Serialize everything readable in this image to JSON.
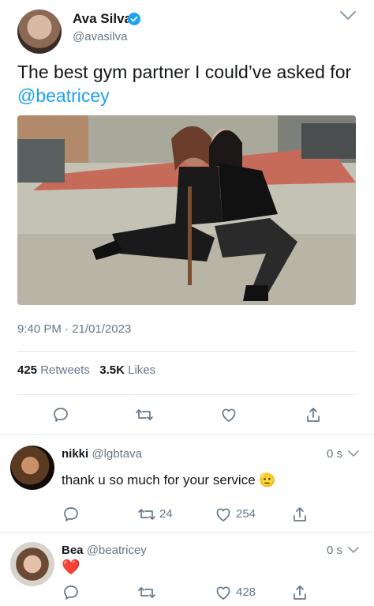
{
  "tweet": {
    "author_name": "Ava Silva",
    "author_handle": "@avasilva",
    "text_main": "The best gym partner I could’ve asked for",
    "text_mention": "@beatricey",
    "time": "9:40 PM",
    "separator": "·",
    "date": "21/01/2023",
    "retweets_count": "425",
    "retweets_label": "Retweets",
    "likes_count": "3.5K",
    "likes_label": "Likes"
  },
  "replies": [
    {
      "name": "nikki",
      "handle": "@lgbtava",
      "time": "0 s",
      "text": "thank u so much for your service",
      "emoji": "🫡",
      "retweets": "24",
      "likes": "254"
    },
    {
      "name": "Bea",
      "handle": "@beatricey",
      "time": "0 s",
      "text": "❤️",
      "likes": "428"
    }
  ],
  "colors": {
    "accent": "#1da1f2",
    "text": "#14171a",
    "muted": "#657786",
    "divider": "#e1e8ed"
  },
  "icons": {
    "verified": "verified-badge-icon",
    "reply": "reply-icon",
    "retweet": "retweet-icon",
    "like": "heart-icon",
    "share": "share-icon",
    "menu": "chevron-down-icon"
  }
}
